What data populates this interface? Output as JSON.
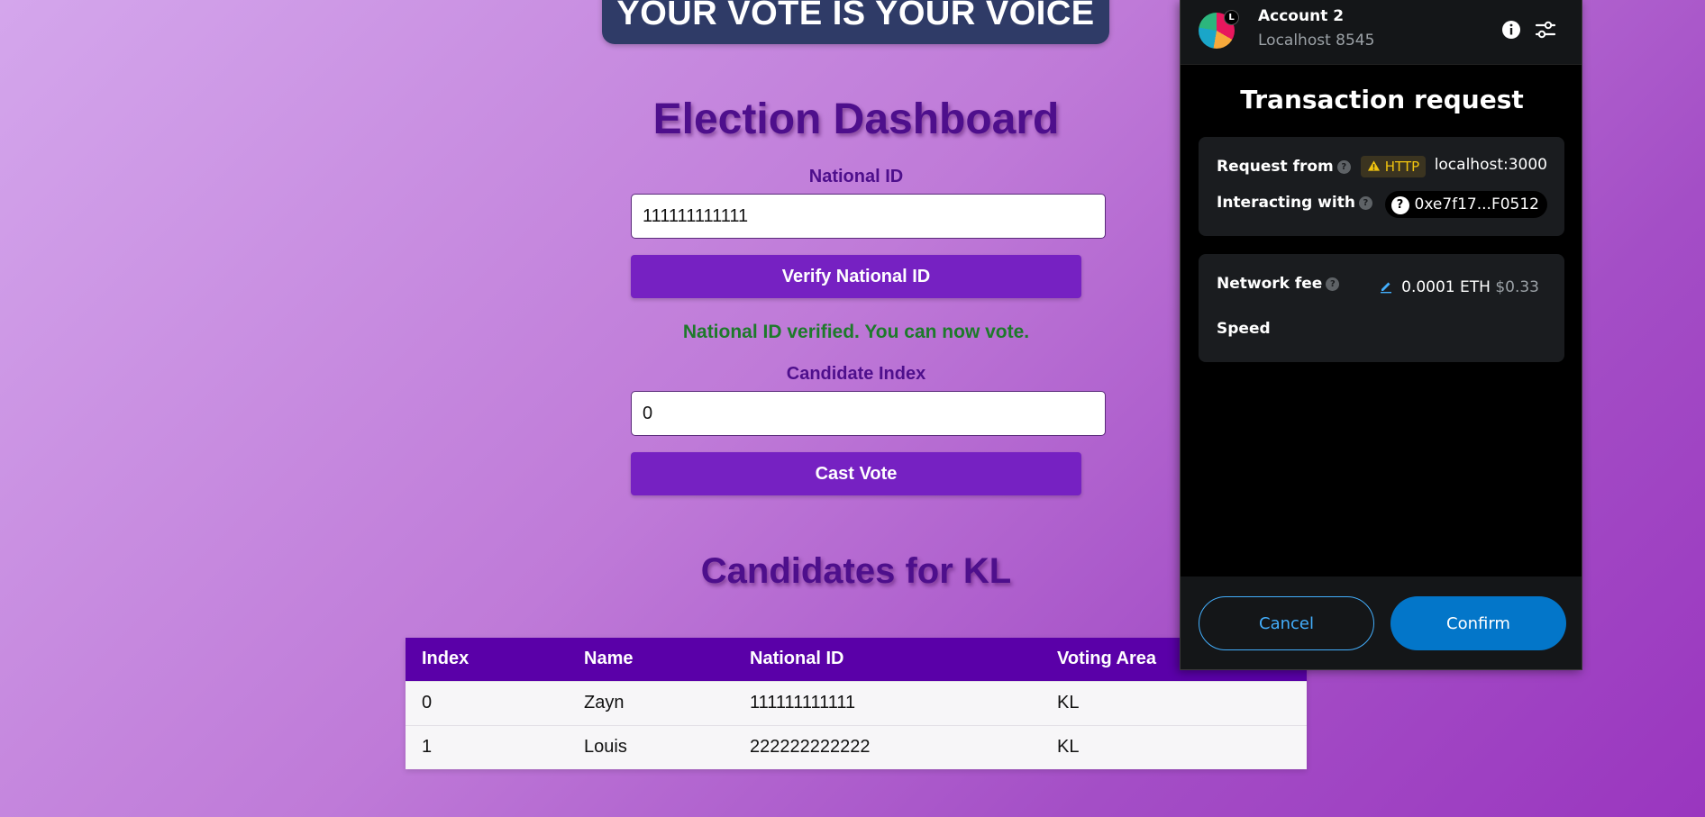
{
  "banner": {
    "text": "YOUR VOTE IS YOUR VOICE"
  },
  "dashboard": {
    "title": "Election Dashboard",
    "national_id_label": "National ID",
    "national_id_value": "111111111111",
    "verify_button": "Verify National ID",
    "status_message": "National ID verified. You can now vote.",
    "candidate_index_label": "Candidate Index",
    "candidate_index_value": "0",
    "cast_vote_button": "Cast Vote"
  },
  "candidates": {
    "title": "Candidates for KL",
    "columns": [
      "Index",
      "Name",
      "National ID",
      "Voting Area"
    ],
    "rows": [
      [
        "0",
        "Zayn",
        "111111111111",
        "KL"
      ],
      [
        "1",
        "Louis",
        "222222222222",
        "KL"
      ]
    ]
  },
  "wallet": {
    "account_name": "Account 2",
    "avatar_badge": "L",
    "network": "Localhost 8545",
    "title": "Transaction request",
    "request_from_label": "Request from",
    "http_badge": "HTTP",
    "origin": "localhost:3000",
    "interacting_with_label": "Interacting with",
    "contract_address": "0xe7f17...F0512",
    "network_fee_label": "Network fee",
    "fee_eth": "0.0001 ETH",
    "fee_usd": "$0.33",
    "speed_label": "Speed",
    "cancel_button": "Cancel",
    "confirm_button": "Confirm"
  },
  "colors": {
    "accent_purple": "#7621c2",
    "table_header": "#5a00a8",
    "success_green": "#1d7a2a",
    "wallet_primary": "#0376c9",
    "wallet_link": "#43aefc"
  },
  "icons": [
    "warning-icon",
    "help-icon",
    "info-icon",
    "settings-sliders-icon",
    "pencil-icon",
    "unknown-contract-icon"
  ]
}
